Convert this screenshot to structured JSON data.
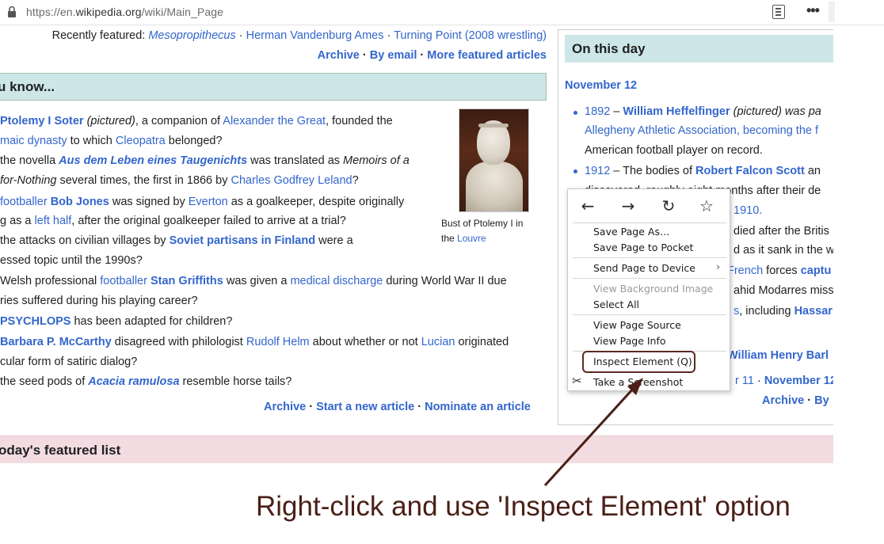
{
  "browser": {
    "url_prefix": "https://en.",
    "url_domain": "wikipedia.org",
    "url_path": "/wiki/Main_Page",
    "menu_dots": "•••"
  },
  "tfa": {
    "recently_label": "Recently featured:",
    "recent_1": "Mesopropithecus",
    "recent_2": "Herman Vandenburg Ames",
    "recent_3": "Turning Point (2008 wrestling)",
    "archive": "Archive",
    "by_email": "By email",
    "more": "More featured articles",
    "sep": " · "
  },
  "dyk": {
    "heading": "u know...",
    "lines": [
      "Ptolemy I Soter (pictured), a companion of Alexander the Great, founded the",
      "maic dynasty to which Cleopatra belonged?",
      "the novella Aus dem Leben eines Taugenichts was translated as Memoirs of a",
      "for-Nothing several times, the first in 1866 by Charles Godfrey Leland?",
      "footballer Bob Jones was signed by Everton as a goalkeeper, despite originally",
      "g as a left half, after the original goalkeeper failed to arrive at a trial?",
      "the attacks on civilian villages by Soviet partisans in Finland were a",
      "essed topic until the 1990s?",
      "Welsh professional footballer Stan Griffiths was given a medical discharge during World War II due",
      "ries suffered during his playing career?",
      "PSYCHLOPS has been adapted for children?",
      "Barbara P. McCarthy disagreed with philologist Rudolf Helm about whether or not Lucian originated",
      "cular form of satiric dialog?",
      "the seed pods of Acacia ramulosa resemble horse tails?"
    ],
    "caption_1": "Bust of Ptolemy I in",
    "caption_2": "the",
    "caption_link": "Louvre",
    "foot_archive": "Archive",
    "foot_new": "Start a new article",
    "foot_nominate": "Nominate an article"
  },
  "tfl": {
    "heading": "oday's featured list"
  },
  "otd": {
    "heading": "On this day",
    "date": "November 12",
    "l1_year": "1892",
    "l1_name": "William Heffelfinger",
    "l1_rest": " (pictured) was pa",
    "l2": "Allegheny Athletic Association, becoming the f",
    "l3": "American football player on record.",
    "l4_year": "1912",
    "l4_rest": " – The bodies of ",
    "l4_name": "Robert Falcon Scott",
    "l4_end": " an",
    "l5": "discovered, roughly eight months after their de",
    "l6": "1910.",
    "l7": "died after the Britis",
    "l8": "d as it sank in the w",
    "l9_a": "French",
    "l9_b": " forces ",
    "l9_c": "captu",
    "l10": "ahid Modarres missi",
    "l11_a": "s",
    "l11_b": ", including ",
    "l11_c": "Hassar",
    "l12": "William Henry Barl",
    "foot1_a": "r 11",
    "foot1_sep": " · ",
    "foot1_b": "November 12",
    "foot2_a": "Archive",
    "foot2_sep": " · ",
    "foot2_b": "By"
  },
  "context_menu": {
    "back": "←",
    "forward": "→",
    "reload": "↻",
    "bookmark": "☆",
    "items": [
      "Save Page As…",
      "Save Page to Pocket",
      "Send Page to Device",
      "View Background Image",
      "Select All",
      "View Page Source",
      "View Page Info",
      "Inspect Element (Q)",
      "Take a Screenshot"
    ],
    "submenu_arrow": "›"
  },
  "annotation": {
    "text": "Right-click and use 'Inspect Element' option",
    "color": "#4a1f16"
  }
}
